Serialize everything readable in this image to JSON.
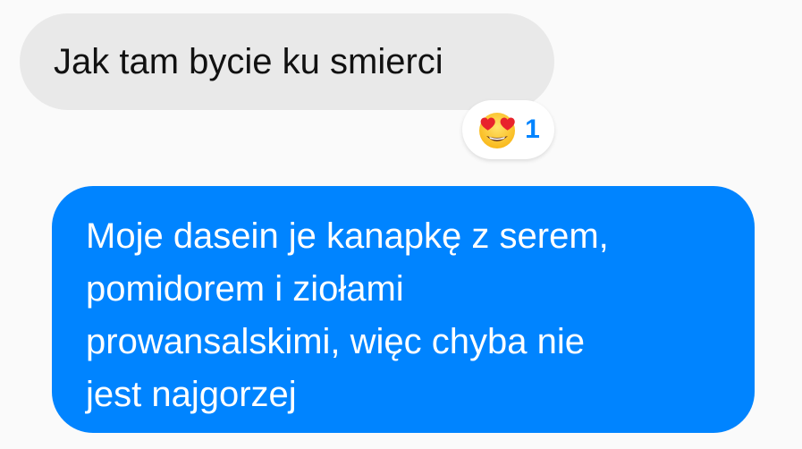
{
  "conversation": {
    "incoming_message": {
      "text": "Jak tam bycie ku smierci",
      "reaction": {
        "emoji": "smiling-face-with-heart-eyes",
        "count": "1",
        "color": "#0084ff"
      }
    },
    "outgoing_message": {
      "lines": [
        "Moje dasein je kanapkę z serem,",
        "pomidorem i ziołami",
        "prowansalskimi, więc chyba nie",
        "jest najgorzej"
      ]
    }
  },
  "colors": {
    "incoming_bubble": "#e9e9e9",
    "outgoing_bubble": "#0084ff",
    "background": "#fafafa"
  }
}
